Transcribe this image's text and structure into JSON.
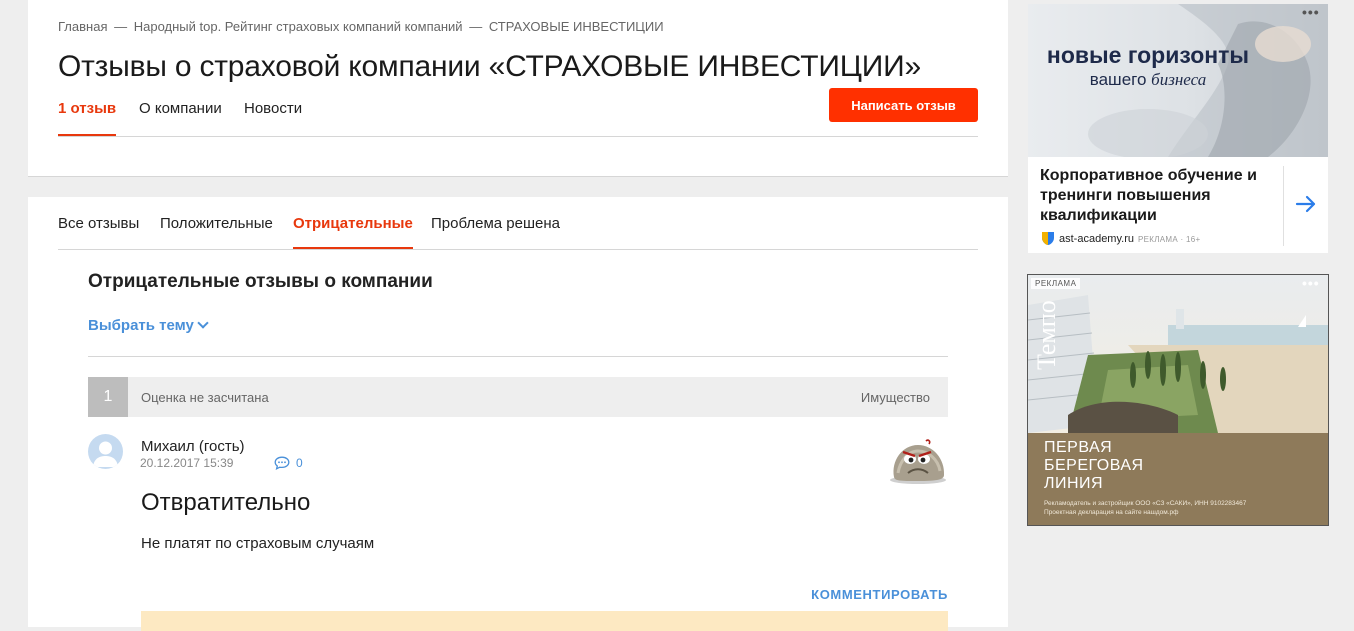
{
  "breadcrumb": [
    "Главная",
    "Народный top. Рейтинг страховых компаний компаний",
    "СТРАХОВЫЕ ИНВЕСТИЦИИ"
  ],
  "page_title": "Отзывы о страховой компании «СТРАХОВЫЕ ИНВЕСТИЦИИ»",
  "main_tabs": [
    "1 отзыв",
    "О компании",
    "Новости"
  ],
  "write_review_label": "Написать отзыв",
  "filter_tabs": [
    "Все отзывы",
    "Положительные",
    "Отрицательные",
    "Проблема решена"
  ],
  "section_title": "Отрицательные отзывы о компании",
  "theme_select_label": "Выбрать тему",
  "review": {
    "number": "1",
    "score_note": "Оценка не засчитана",
    "category": "Имущество",
    "author": "Михаил (гость)",
    "date": "20.12.2017 15:39",
    "comments_count": "0",
    "title": "Отвратительно",
    "text": "Не платят по страховым случаям",
    "comment_link": "КОММЕНТИРОВАТЬ"
  },
  "ad1": {
    "headline": "новые горизонты",
    "sub_prefix": "вашего",
    "sub_italic": "бизнеса",
    "body": "Корпоративное обучение и тренинги повышения квалификации",
    "site": "ast-academy.ru",
    "label": "РЕКЛАМА · 16+",
    "icon": "arrow-right-icon"
  },
  "ad2": {
    "label": "РЕКЛАМА",
    "logo": "Темпо",
    "headline": [
      "ПЕРВАЯ",
      "БЕРЕГОВАЯ",
      "ЛИНИЯ"
    ],
    "footer": [
      "Рекламодатель и застройщик ООО «СЗ «САКИ», ИНН 9102283467",
      "Проектная декларация на сайте нашдом.рф"
    ]
  },
  "colors": {
    "accent": "#ff3000",
    "active_tab": "#e8380d",
    "link": "#4a90d9",
    "background": "#eeeeee"
  }
}
